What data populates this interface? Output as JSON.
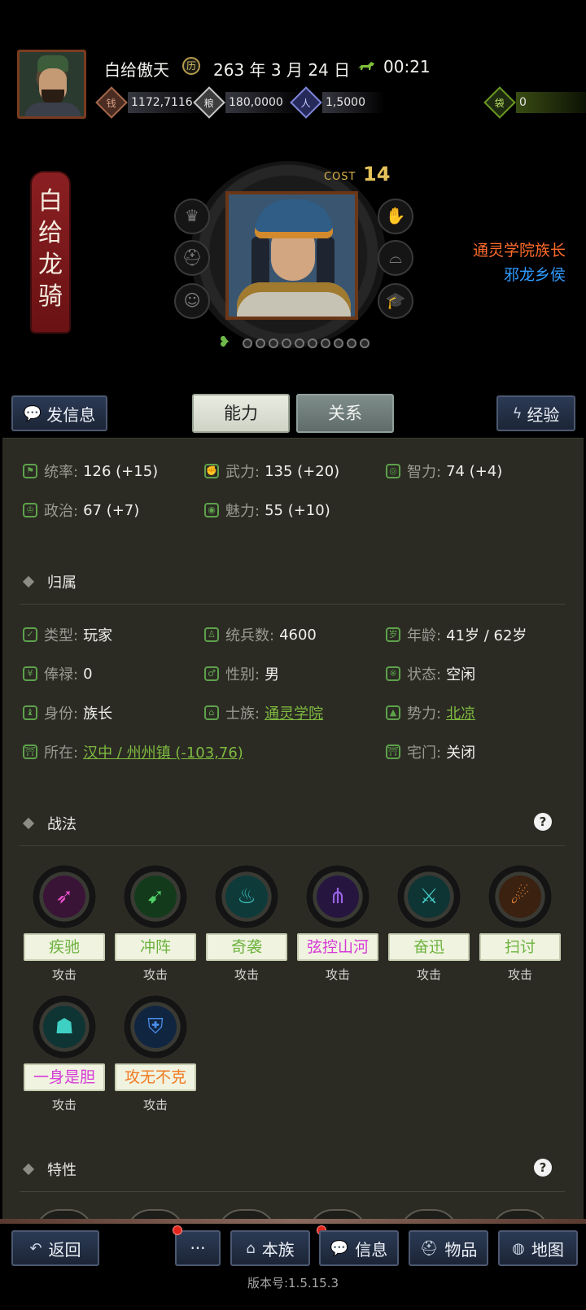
{
  "header": {
    "player_name": "白给傲天",
    "date": "263 年 3 月 24 日",
    "time": "00:21",
    "resources": {
      "silver": "1172,7116",
      "gold": "180,0000",
      "merit": "1,5000",
      "seed": "0"
    }
  },
  "general": {
    "title_chars": [
      "白",
      "给",
      "龙",
      "骑"
    ],
    "cost_label": "COST",
    "cost_value": "14",
    "tag_primary": "通灵学院族长",
    "tag_secondary": "邪龙乡侯"
  },
  "tabs": {
    "send_message": "发信息",
    "ability": "能力",
    "relation": "关系",
    "experience": "经验"
  },
  "stats": {
    "command_label": "统率:",
    "command_value": "126 (+15)",
    "force_label": "武力:",
    "force_value": "135 (+20)",
    "intel_label": "智力:",
    "intel_value": "74 (+4)",
    "politics_label": "政治:",
    "politics_value": "67 (+7)",
    "charm_label": "魅力:",
    "charm_value": "55 (+10)"
  },
  "affiliation": {
    "section_title": "归属",
    "type_label": "类型:",
    "type_value": "玩家",
    "troops_label": "统兵数:",
    "troops_value": "4600",
    "age_label": "年龄:",
    "age_value": "41岁 / 62岁",
    "salary_label": "俸禄:",
    "salary_value": "0",
    "gender_label": "性别:",
    "gender_value": "男",
    "status_label": "状态:",
    "status_value": "空闲",
    "identity_label": "身份:",
    "identity_value": "族长",
    "clan_label": "士族:",
    "clan_value": "通灵学院",
    "faction_label": "势力:",
    "faction_value": "北凉",
    "location_label": "所在:",
    "location_value": "汉中 / 州州镇 (-103,76)",
    "gate_label": "宅门:",
    "gate_value": "关闭"
  },
  "tactics": {
    "section_title": "战法",
    "help": "?",
    "skills": [
      {
        "name": "疾驰",
        "type": "攻击",
        "color": "#6db33f"
      },
      {
        "name": "冲阵",
        "type": "攻击",
        "color": "#6db33f"
      },
      {
        "name": "奇袭",
        "type": "攻击",
        "color": "#6db33f"
      },
      {
        "name": "弦控山河",
        "type": "攻击",
        "color": "#d63ad6"
      },
      {
        "name": "奋迅",
        "type": "攻击",
        "color": "#6db33f"
      },
      {
        "name": "扫讨",
        "type": "攻击",
        "color": "#6db33f"
      },
      {
        "name": "一身是胆",
        "type": "攻击",
        "color": "#d63ad6"
      },
      {
        "name": "攻无不克",
        "type": "攻击",
        "color": "#f07a22"
      }
    ]
  },
  "traits": {
    "section_title": "特性",
    "help": "?"
  },
  "nav": {
    "back": "返回",
    "more": "···",
    "clan": "本族",
    "info": "信息",
    "items": "物品",
    "map": "地图"
  },
  "version": "版本号:1.5.15.3"
}
